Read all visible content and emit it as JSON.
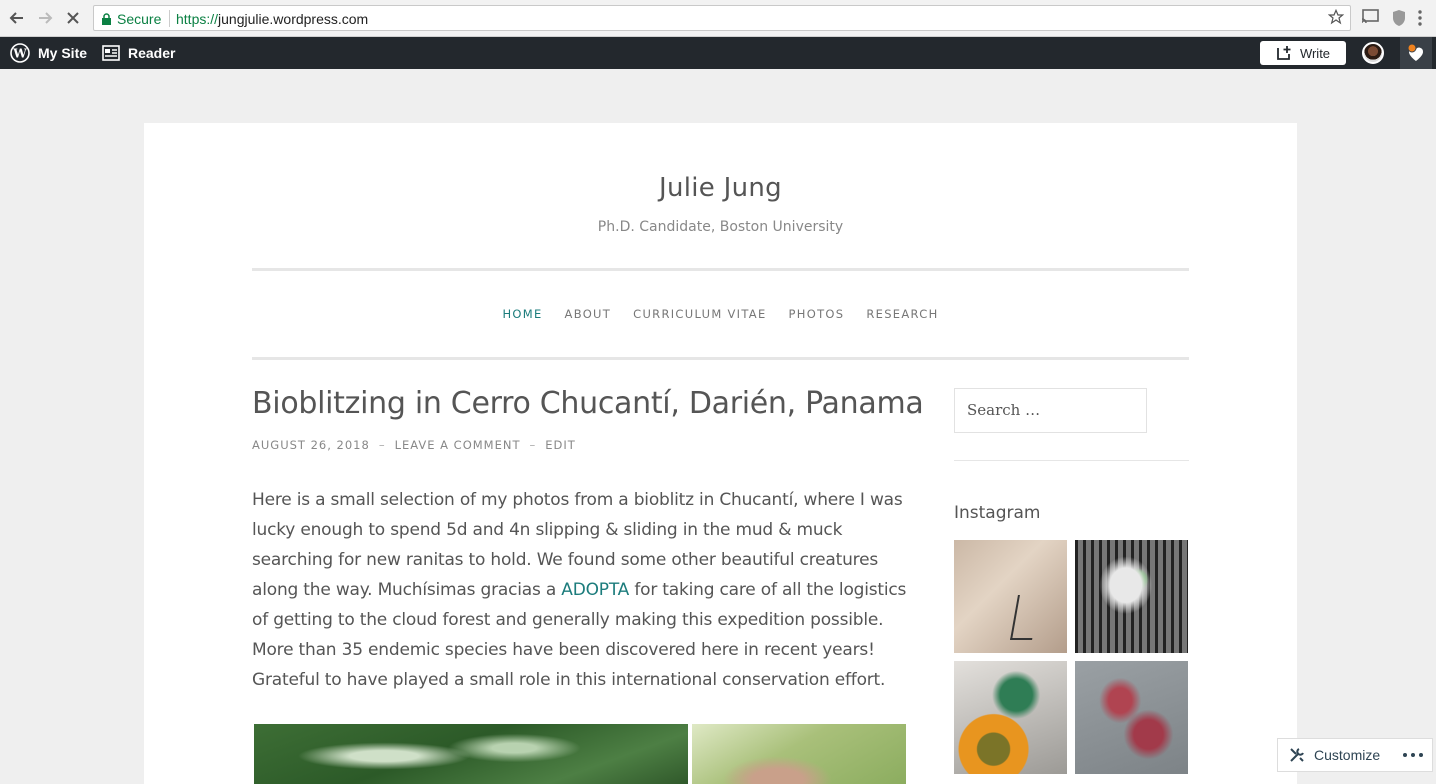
{
  "browser": {
    "secure_label": "Secure",
    "url_scheme": "https://",
    "url_host": "jungjulie.wordpress.com"
  },
  "adminbar": {
    "my_site": "My Site",
    "reader": "Reader",
    "write": "Write"
  },
  "site": {
    "title": "Julie Jung",
    "description": "Ph.D. Candidate, Boston University"
  },
  "menu": {
    "items": [
      "HOME",
      "ABOUT",
      "CURRICULUM VITAE",
      "PHOTOS",
      "RESEARCH"
    ],
    "active": "HOME"
  },
  "post": {
    "title": "Bioblitzing in Cerro Chucantí, Darién, Panama",
    "date": "AUGUST 26, 2018",
    "leave_comment": "LEAVE A COMMENT",
    "edit": "EDIT",
    "body_before_link": "Here is a small selection of my photos from a bioblitz in Chucantí, where I was lucky enough to spend 5d and 4n slipping & sliding in the mud & muck searching for new ranitas to hold. We found some other beautiful creatures along the way. Muchísimas gracias a ",
    "link_text": "ADOPTA",
    "body_after_link": " for taking care of all the logistics of getting to the cloud forest and generally making this expedition possible. More than 35 endemic species have been discovered here in recent years! Grateful to have played a small role in this international conservation effort."
  },
  "sidebar": {
    "search_placeholder": "Search …",
    "instagram_title": "Instagram"
  },
  "customize": {
    "label": "Customize"
  },
  "colors": {
    "accent": "#1c7c7c",
    "adminbar": "#23282d",
    "secure_green": "#0b8043"
  }
}
